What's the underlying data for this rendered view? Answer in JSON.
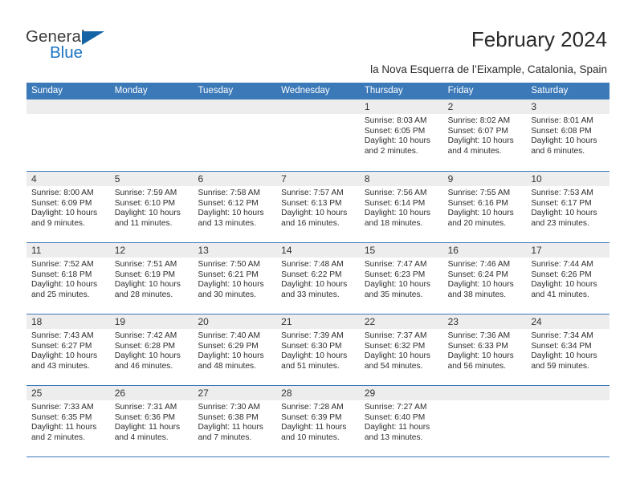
{
  "logo": {
    "word1": "General",
    "word2": "Blue",
    "triangle_color": "#1464a5",
    "blue_color": "#1a74c4"
  },
  "header": {
    "title": "February 2024",
    "subtitle": "la Nova Esquerra de l’Eixample, Catalonia, Spain"
  },
  "theme": {
    "header_blue": "#3b79b8",
    "date_band_gray": "#ededed",
    "text_color": "#2d2d2d"
  },
  "calendar": {
    "weekdays": [
      "Sunday",
      "Monday",
      "Tuesday",
      "Wednesday",
      "Thursday",
      "Friday",
      "Saturday"
    ],
    "weeks": [
      [
        {
          "day": "",
          "lines": []
        },
        {
          "day": "",
          "lines": []
        },
        {
          "day": "",
          "lines": []
        },
        {
          "day": "",
          "lines": []
        },
        {
          "day": "1",
          "lines": [
            "Sunrise: 8:03 AM",
            "Sunset: 6:05 PM",
            "Daylight: 10 hours",
            "and 2 minutes."
          ]
        },
        {
          "day": "2",
          "lines": [
            "Sunrise: 8:02 AM",
            "Sunset: 6:07 PM",
            "Daylight: 10 hours",
            "and 4 minutes."
          ]
        },
        {
          "day": "3",
          "lines": [
            "Sunrise: 8:01 AM",
            "Sunset: 6:08 PM",
            "Daylight: 10 hours",
            "and 6 minutes."
          ]
        }
      ],
      [
        {
          "day": "4",
          "lines": [
            "Sunrise: 8:00 AM",
            "Sunset: 6:09 PM",
            "Daylight: 10 hours",
            "and 9 minutes."
          ]
        },
        {
          "day": "5",
          "lines": [
            "Sunrise: 7:59 AM",
            "Sunset: 6:10 PM",
            "Daylight: 10 hours",
            "and 11 minutes."
          ]
        },
        {
          "day": "6",
          "lines": [
            "Sunrise: 7:58 AM",
            "Sunset: 6:12 PM",
            "Daylight: 10 hours",
            "and 13 minutes."
          ]
        },
        {
          "day": "7",
          "lines": [
            "Sunrise: 7:57 AM",
            "Sunset: 6:13 PM",
            "Daylight: 10 hours",
            "and 16 minutes."
          ]
        },
        {
          "day": "8",
          "lines": [
            "Sunrise: 7:56 AM",
            "Sunset: 6:14 PM",
            "Daylight: 10 hours",
            "and 18 minutes."
          ]
        },
        {
          "day": "9",
          "lines": [
            "Sunrise: 7:55 AM",
            "Sunset: 6:16 PM",
            "Daylight: 10 hours",
            "and 20 minutes."
          ]
        },
        {
          "day": "10",
          "lines": [
            "Sunrise: 7:53 AM",
            "Sunset: 6:17 PM",
            "Daylight: 10 hours",
            "and 23 minutes."
          ]
        }
      ],
      [
        {
          "day": "11",
          "lines": [
            "Sunrise: 7:52 AM",
            "Sunset: 6:18 PM",
            "Daylight: 10 hours",
            "and 25 minutes."
          ]
        },
        {
          "day": "12",
          "lines": [
            "Sunrise: 7:51 AM",
            "Sunset: 6:19 PM",
            "Daylight: 10 hours",
            "and 28 minutes."
          ]
        },
        {
          "day": "13",
          "lines": [
            "Sunrise: 7:50 AM",
            "Sunset: 6:21 PM",
            "Daylight: 10 hours",
            "and 30 minutes."
          ]
        },
        {
          "day": "14",
          "lines": [
            "Sunrise: 7:48 AM",
            "Sunset: 6:22 PM",
            "Daylight: 10 hours",
            "and 33 minutes."
          ]
        },
        {
          "day": "15",
          "lines": [
            "Sunrise: 7:47 AM",
            "Sunset: 6:23 PM",
            "Daylight: 10 hours",
            "and 35 minutes."
          ]
        },
        {
          "day": "16",
          "lines": [
            "Sunrise: 7:46 AM",
            "Sunset: 6:24 PM",
            "Daylight: 10 hours",
            "and 38 minutes."
          ]
        },
        {
          "day": "17",
          "lines": [
            "Sunrise: 7:44 AM",
            "Sunset: 6:26 PM",
            "Daylight: 10 hours",
            "and 41 minutes."
          ]
        }
      ],
      [
        {
          "day": "18",
          "lines": [
            "Sunrise: 7:43 AM",
            "Sunset: 6:27 PM",
            "Daylight: 10 hours",
            "and 43 minutes."
          ]
        },
        {
          "day": "19",
          "lines": [
            "Sunrise: 7:42 AM",
            "Sunset: 6:28 PM",
            "Daylight: 10 hours",
            "and 46 minutes."
          ]
        },
        {
          "day": "20",
          "lines": [
            "Sunrise: 7:40 AM",
            "Sunset: 6:29 PM",
            "Daylight: 10 hours",
            "and 48 minutes."
          ]
        },
        {
          "day": "21",
          "lines": [
            "Sunrise: 7:39 AM",
            "Sunset: 6:30 PM",
            "Daylight: 10 hours",
            "and 51 minutes."
          ]
        },
        {
          "day": "22",
          "lines": [
            "Sunrise: 7:37 AM",
            "Sunset: 6:32 PM",
            "Daylight: 10 hours",
            "and 54 minutes."
          ]
        },
        {
          "day": "23",
          "lines": [
            "Sunrise: 7:36 AM",
            "Sunset: 6:33 PM",
            "Daylight: 10 hours",
            "and 56 minutes."
          ]
        },
        {
          "day": "24",
          "lines": [
            "Sunrise: 7:34 AM",
            "Sunset: 6:34 PM",
            "Daylight: 10 hours",
            "and 59 minutes."
          ]
        }
      ],
      [
        {
          "day": "25",
          "lines": [
            "Sunrise: 7:33 AM",
            "Sunset: 6:35 PM",
            "Daylight: 11 hours",
            "and 2 minutes."
          ]
        },
        {
          "day": "26",
          "lines": [
            "Sunrise: 7:31 AM",
            "Sunset: 6:36 PM",
            "Daylight: 11 hours",
            "and 4 minutes."
          ]
        },
        {
          "day": "27",
          "lines": [
            "Sunrise: 7:30 AM",
            "Sunset: 6:38 PM",
            "Daylight: 11 hours",
            "and 7 minutes."
          ]
        },
        {
          "day": "28",
          "lines": [
            "Sunrise: 7:28 AM",
            "Sunset: 6:39 PM",
            "Daylight: 11 hours",
            "and 10 minutes."
          ]
        },
        {
          "day": "29",
          "lines": [
            "Sunrise: 7:27 AM",
            "Sunset: 6:40 PM",
            "Daylight: 11 hours",
            "and 13 minutes."
          ]
        },
        {
          "day": "",
          "lines": []
        },
        {
          "day": "",
          "lines": []
        }
      ]
    ]
  }
}
